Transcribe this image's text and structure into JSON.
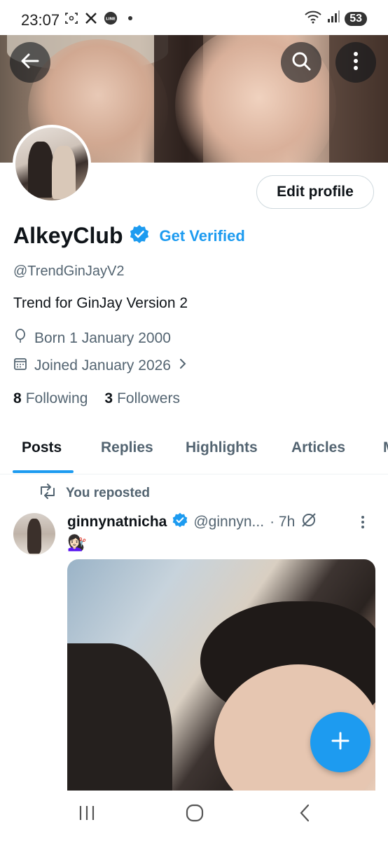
{
  "status_bar": {
    "time": "23:07",
    "left_icons": [
      "screenshot-icon",
      "x-app-icon",
      "line-app-icon",
      "dot-icon"
    ],
    "battery": "53"
  },
  "header": {
    "back_icon": "arrow-left-icon",
    "search_icon": "search-icon",
    "more_icon": "more-vertical-icon"
  },
  "profile": {
    "edit_label": "Edit profile",
    "name": "AlkeyClub",
    "get_verified_label": "Get Verified",
    "handle": "@TrendGinJayV2",
    "bio": "Trend for GinJay Version 2",
    "born": "Born 1 January 2000",
    "joined": "Joined January 2026",
    "following_count": "8",
    "following_label": "Following",
    "followers_count": "3",
    "followers_label": "Followers"
  },
  "tabs": [
    {
      "label": "Posts",
      "active": true
    },
    {
      "label": "Replies",
      "active": false
    },
    {
      "label": "Highlights",
      "active": false
    },
    {
      "label": "Articles",
      "active": false
    },
    {
      "label": "M",
      "active": false
    }
  ],
  "post": {
    "repost_label": "You reposted",
    "author": "ginnynatnicha",
    "handle": "@ginnyn...",
    "time": "· 7h",
    "emoji": "💇🏻‍♀️"
  },
  "colors": {
    "accent": "#1d9bf0",
    "text_primary": "#0f1419",
    "text_secondary": "#536471"
  }
}
